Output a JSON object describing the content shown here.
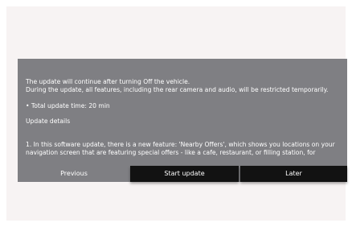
{
  "dialog": {
    "line1": "The update will continue after turning Off the vehicle.",
    "line2": "During the update, all features, including the rear camera and audio, will be restricted temporarily.",
    "total_time": "• Total update time: 20 min",
    "details_label": "Update details",
    "detail_line1": "1. In this software update, there is a new feature: 'Nearby Offers', which shows you locations on your",
    "detail_line2": "navigation screen that are featuring special offers - like a cafe, restaurant, or filling station, for"
  },
  "buttons": {
    "previous": "Previous",
    "start_update": "Start update",
    "later": "Later"
  },
  "colors": {
    "dialog_bg": "#7f7f83",
    "button_bg": "#121212",
    "frame_bg": "#f7f3f3"
  }
}
